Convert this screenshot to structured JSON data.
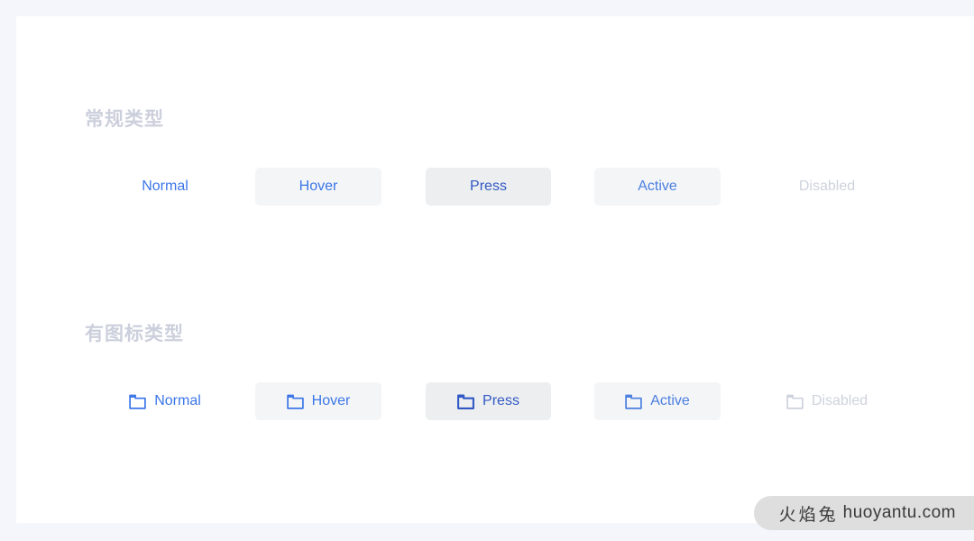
{
  "theme": {
    "page_background": "#f4f6fb",
    "card_background": "#ffffff",
    "accent_blue": "#3b76e8",
    "press_blue": "#3258c4",
    "disabled_gray": "#ced2dc",
    "hover_bg": "#f4f5f7",
    "press_bg": "#eceef0",
    "title_gray": "#ccd0dc"
  },
  "sections": [
    {
      "title": "常规类型",
      "buttons": [
        {
          "label": "Normal",
          "state": "normal",
          "icon": null
        },
        {
          "label": "Hover",
          "state": "hover",
          "icon": null
        },
        {
          "label": "Press",
          "state": "press",
          "icon": null
        },
        {
          "label": "Active",
          "state": "active",
          "icon": null
        },
        {
          "label": "Disabled",
          "state": "disabled",
          "icon": null
        }
      ]
    },
    {
      "title": "有图标类型",
      "buttons": [
        {
          "label": "Normal",
          "state": "normal",
          "icon": "folder-icon"
        },
        {
          "label": "Hover",
          "state": "hover",
          "icon": "folder-icon"
        },
        {
          "label": "Press",
          "state": "press",
          "icon": "folder-icon"
        },
        {
          "label": "Active",
          "state": "active",
          "icon": "folder-icon"
        },
        {
          "label": "Disabled",
          "state": "disabled",
          "icon": "folder-icon"
        }
      ]
    }
  ],
  "watermark": {
    "cn_text": "火焰兔",
    "url_text": "huoyantu.com"
  }
}
